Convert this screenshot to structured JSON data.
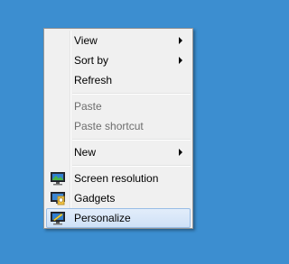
{
  "desktop": {
    "background_color": "#3c8ed0"
  },
  "context_menu": {
    "items": [
      {
        "label": "View",
        "has_submenu": true,
        "enabled": true
      },
      {
        "label": "Sort by",
        "has_submenu": true,
        "enabled": true
      },
      {
        "label": "Refresh",
        "has_submenu": false,
        "enabled": true
      },
      {
        "label": "Paste",
        "has_submenu": false,
        "enabled": false
      },
      {
        "label": "Paste shortcut",
        "has_submenu": false,
        "enabled": false
      },
      {
        "label": "New",
        "has_submenu": true,
        "enabled": true
      },
      {
        "label": "Screen resolution",
        "icon": "monitor-icon",
        "has_submenu": false,
        "enabled": true
      },
      {
        "label": "Gadgets",
        "icon": "gadgets-icon",
        "has_submenu": false,
        "enabled": true
      },
      {
        "label": "Personalize",
        "icon": "personalize-icon",
        "has_submenu": false,
        "enabled": true,
        "highlighted": true
      }
    ]
  }
}
